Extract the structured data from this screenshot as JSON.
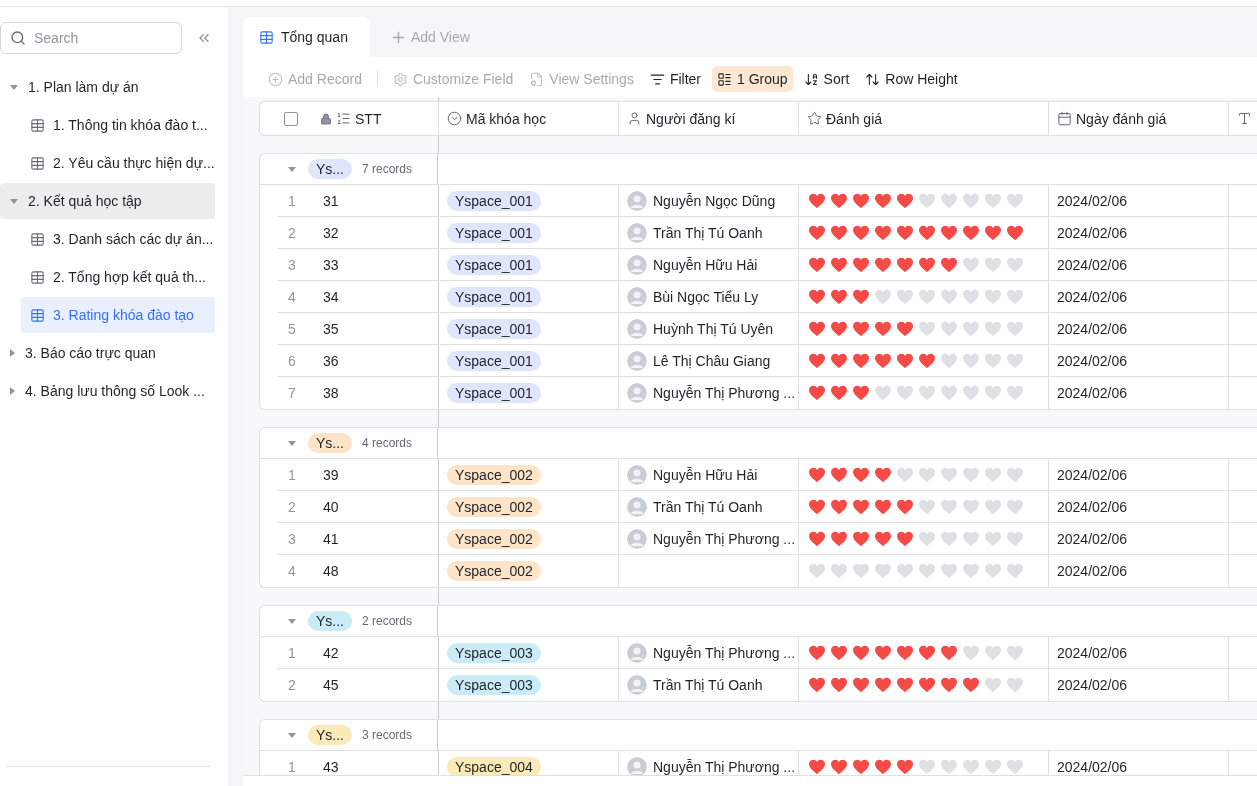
{
  "sidebar": {
    "search": {
      "placeholder": "Search"
    },
    "tree": [
      {
        "label": "1. Plan làm dự án",
        "expanded": true,
        "active": false,
        "children": [
          {
            "label": "1. Thông tin khóa đào t...",
            "selected": false
          },
          {
            "label": "2. Yêu cầu thực hiện dự...",
            "selected": false
          }
        ]
      },
      {
        "label": "2. Kết quả học tập",
        "expanded": true,
        "active": true,
        "children": [
          {
            "label": "3. Danh sách các dự án...",
            "selected": false
          },
          {
            "label": "2. Tổng hợp kết quả th...",
            "selected": false
          },
          {
            "label": "3. Rating khóa đào tạo",
            "selected": true
          }
        ]
      },
      {
        "label": "3. Báo cáo trực quan",
        "expanded": false,
        "active": false
      },
      {
        "label": "4. Bảng lưu thông số Look ...",
        "expanded": false,
        "active": false
      }
    ]
  },
  "tabs": [
    {
      "label": "Tổng quan",
      "selected": true
    }
  ],
  "add_view": "Add View",
  "toolbar": [
    {
      "label": "Add Record",
      "kind": "add",
      "disabled": true,
      "active": false
    },
    {
      "label": "Customize Field",
      "kind": "field",
      "disabled": true,
      "active": false
    },
    {
      "label": "View Settings",
      "kind": "settings",
      "disabled": true,
      "active": false
    },
    {
      "label": "Filter",
      "kind": "filter",
      "disabled": false,
      "active": false
    },
    {
      "label": "1 Group",
      "kind": "group",
      "disabled": false,
      "active": true
    },
    {
      "label": "Sort",
      "kind": "sort",
      "disabled": false,
      "active": false
    },
    {
      "label": "Row Height",
      "kind": "height",
      "disabled": false,
      "active": false
    }
  ],
  "select_all": {
    "checked": false
  },
  "columns": [
    {
      "label": "STT",
      "kind": "number"
    },
    {
      "label": "Mã khóa học",
      "kind": "select"
    },
    {
      "label": "Người đăng kí",
      "kind": "person"
    },
    {
      "label": "Đánh giá",
      "kind": "rating"
    },
    {
      "label": "Ngày đánh giá",
      "kind": "date"
    },
    {
      "kind": "text"
    }
  ],
  "groups": [
    {
      "label": "Ys...",
      "count": "7 records",
      "color": "#dfe6fc",
      "expanded": true,
      "rows": [
        {
          "index": "1",
          "stt": "31",
          "code": "Yspace_001",
          "person": "Nguyễn Ngọc Dũng",
          "stars": 5,
          "date": "2024/02/06"
        },
        {
          "index": "2",
          "stt": "32",
          "code": "Yspace_001",
          "person": "Trần Thị Tú Oanh",
          "stars": 10,
          "date": "2024/02/06"
        },
        {
          "index": "3",
          "stt": "33",
          "code": "Yspace_001",
          "person": "Nguyễn Hữu Hải",
          "stars": 7,
          "date": "2024/02/06"
        },
        {
          "index": "4",
          "stt": "34",
          "code": "Yspace_001",
          "person": "Bùi Ngọc Tiểu Ly",
          "stars": 3,
          "date": "2024/02/06"
        },
        {
          "index": "5",
          "stt": "35",
          "code": "Yspace_001",
          "person": "Huỳnh Thị Tú Uyên",
          "stars": 5,
          "date": "2024/02/06"
        },
        {
          "index": "6",
          "stt": "36",
          "code": "Yspace_001",
          "person": "Lê Thị Châu Giang",
          "stars": 6,
          "date": "2024/02/06"
        },
        {
          "index": "7",
          "stt": "38",
          "code": "Yspace_001",
          "person": "Nguyễn Thị Phương ...",
          "stars": 3,
          "date": "2024/02/06"
        }
      ]
    },
    {
      "label": "Ys...",
      "count": "4 records",
      "color": "#fde3c8",
      "expanded": true,
      "rows": [
        {
          "index": "1",
          "stt": "39",
          "code": "Yspace_002",
          "person": "Nguyễn Hữu Hải",
          "stars": 4,
          "date": "2024/02/06"
        },
        {
          "index": "2",
          "stt": "40",
          "code": "Yspace_002",
          "person": "Trần Thị Tú Oanh",
          "stars": 5,
          "date": "2024/02/06"
        },
        {
          "index": "3",
          "stt": "41",
          "code": "Yspace_002",
          "person": "Nguyễn Thị Phương ...",
          "stars": 5,
          "date": "2024/02/06"
        },
        {
          "index": "4",
          "stt": "48",
          "code": "Yspace_002",
          "stars": 0,
          "date": "2024/02/06"
        }
      ]
    },
    {
      "label": "Ys...",
      "count": "2 records",
      "color": "#caecf9",
      "expanded": true,
      "rows": [
        {
          "index": "1",
          "stt": "42",
          "code": "Yspace_003",
          "person": "Nguyễn Thị Phương ...",
          "stars": 7,
          "date": "2024/02/06"
        },
        {
          "index": "2",
          "stt": "45",
          "code": "Yspace_003",
          "person": "Trần Thị Tú Oanh",
          "stars": 8,
          "date": "2024/02/06"
        }
      ]
    },
    {
      "label": "Ys...",
      "count": "3 records",
      "color": "#fbeab8",
      "expanded": true,
      "rows": [
        {
          "index": "1",
          "stt": "43",
          "code": "Yspace_004",
          "person": "Nguyễn Thị Phương ...",
          "stars": 5,
          "date": "2024/02/06"
        }
      ]
    }
  ]
}
